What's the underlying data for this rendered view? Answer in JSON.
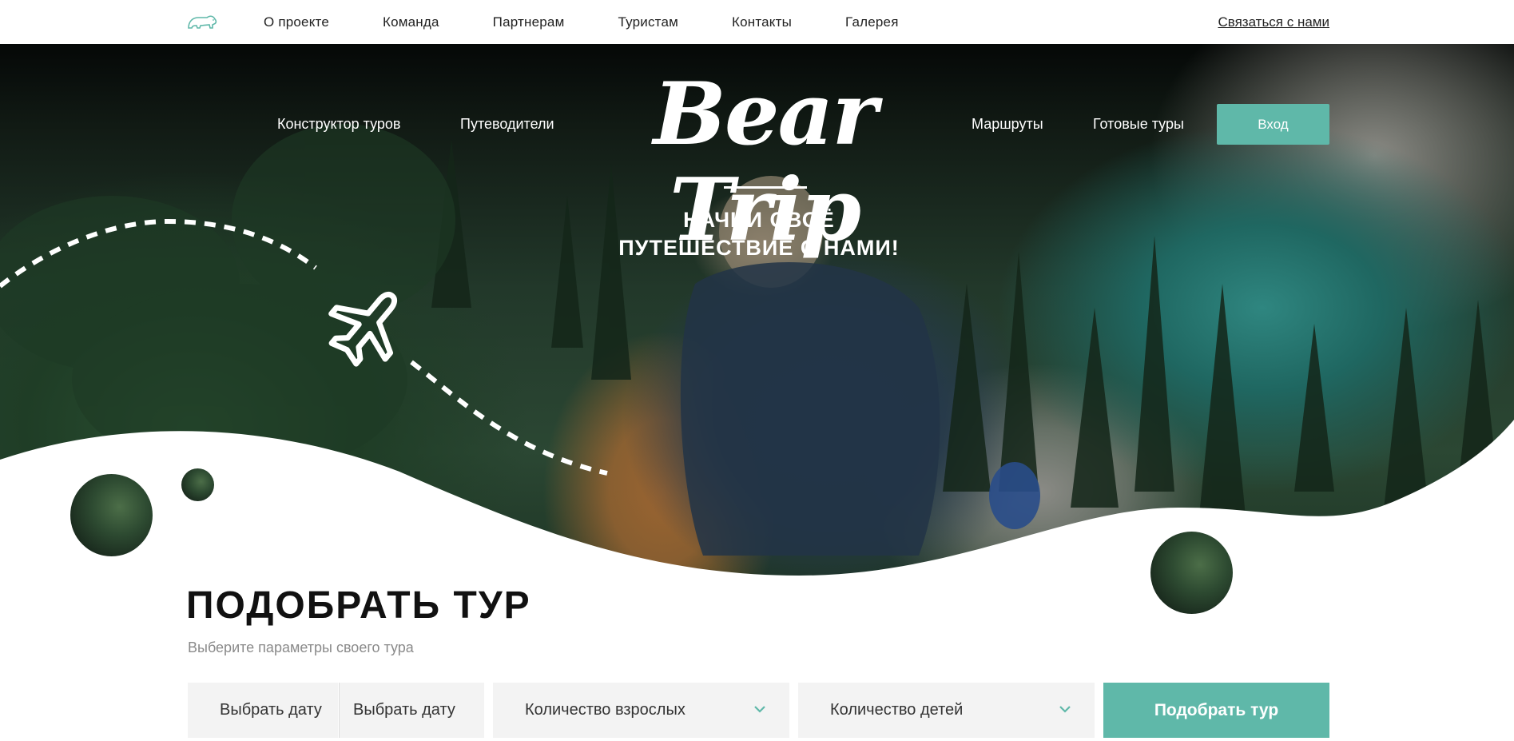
{
  "top_nav": {
    "links": [
      "О проекте",
      "Команда",
      "Партнерам",
      "Туристам",
      "Контакты",
      "Галерея"
    ],
    "contact_link": "Связаться с нами"
  },
  "hero": {
    "nav_left": [
      "Конструктор туров",
      "Путеводители"
    ],
    "nav_right": [
      "Маршруты",
      "Готовые туры"
    ],
    "login_label": "Вход",
    "brand": "Bear Trip",
    "slogan_line1": "НАЧНИ СВОЁ",
    "slogan_line2": "ПУТЕШЕСТВИЕ С НАМИ!"
  },
  "tour_picker": {
    "title": "ПОДОБРАТЬ ТУР",
    "subtitle": "Выберите параметры своего тура",
    "date_from": "Выбрать дату",
    "date_to": "Выбрать дату",
    "adults": "Количество взрослых",
    "children": "Количество детей",
    "submit_label": "Подобрать тур"
  },
  "colors": {
    "accent": "#5fb8a9",
    "field_bg": "#f3f3f3"
  },
  "icons": [
    "bear-logo-icon",
    "airplane-icon",
    "chevron-down-icon"
  ]
}
